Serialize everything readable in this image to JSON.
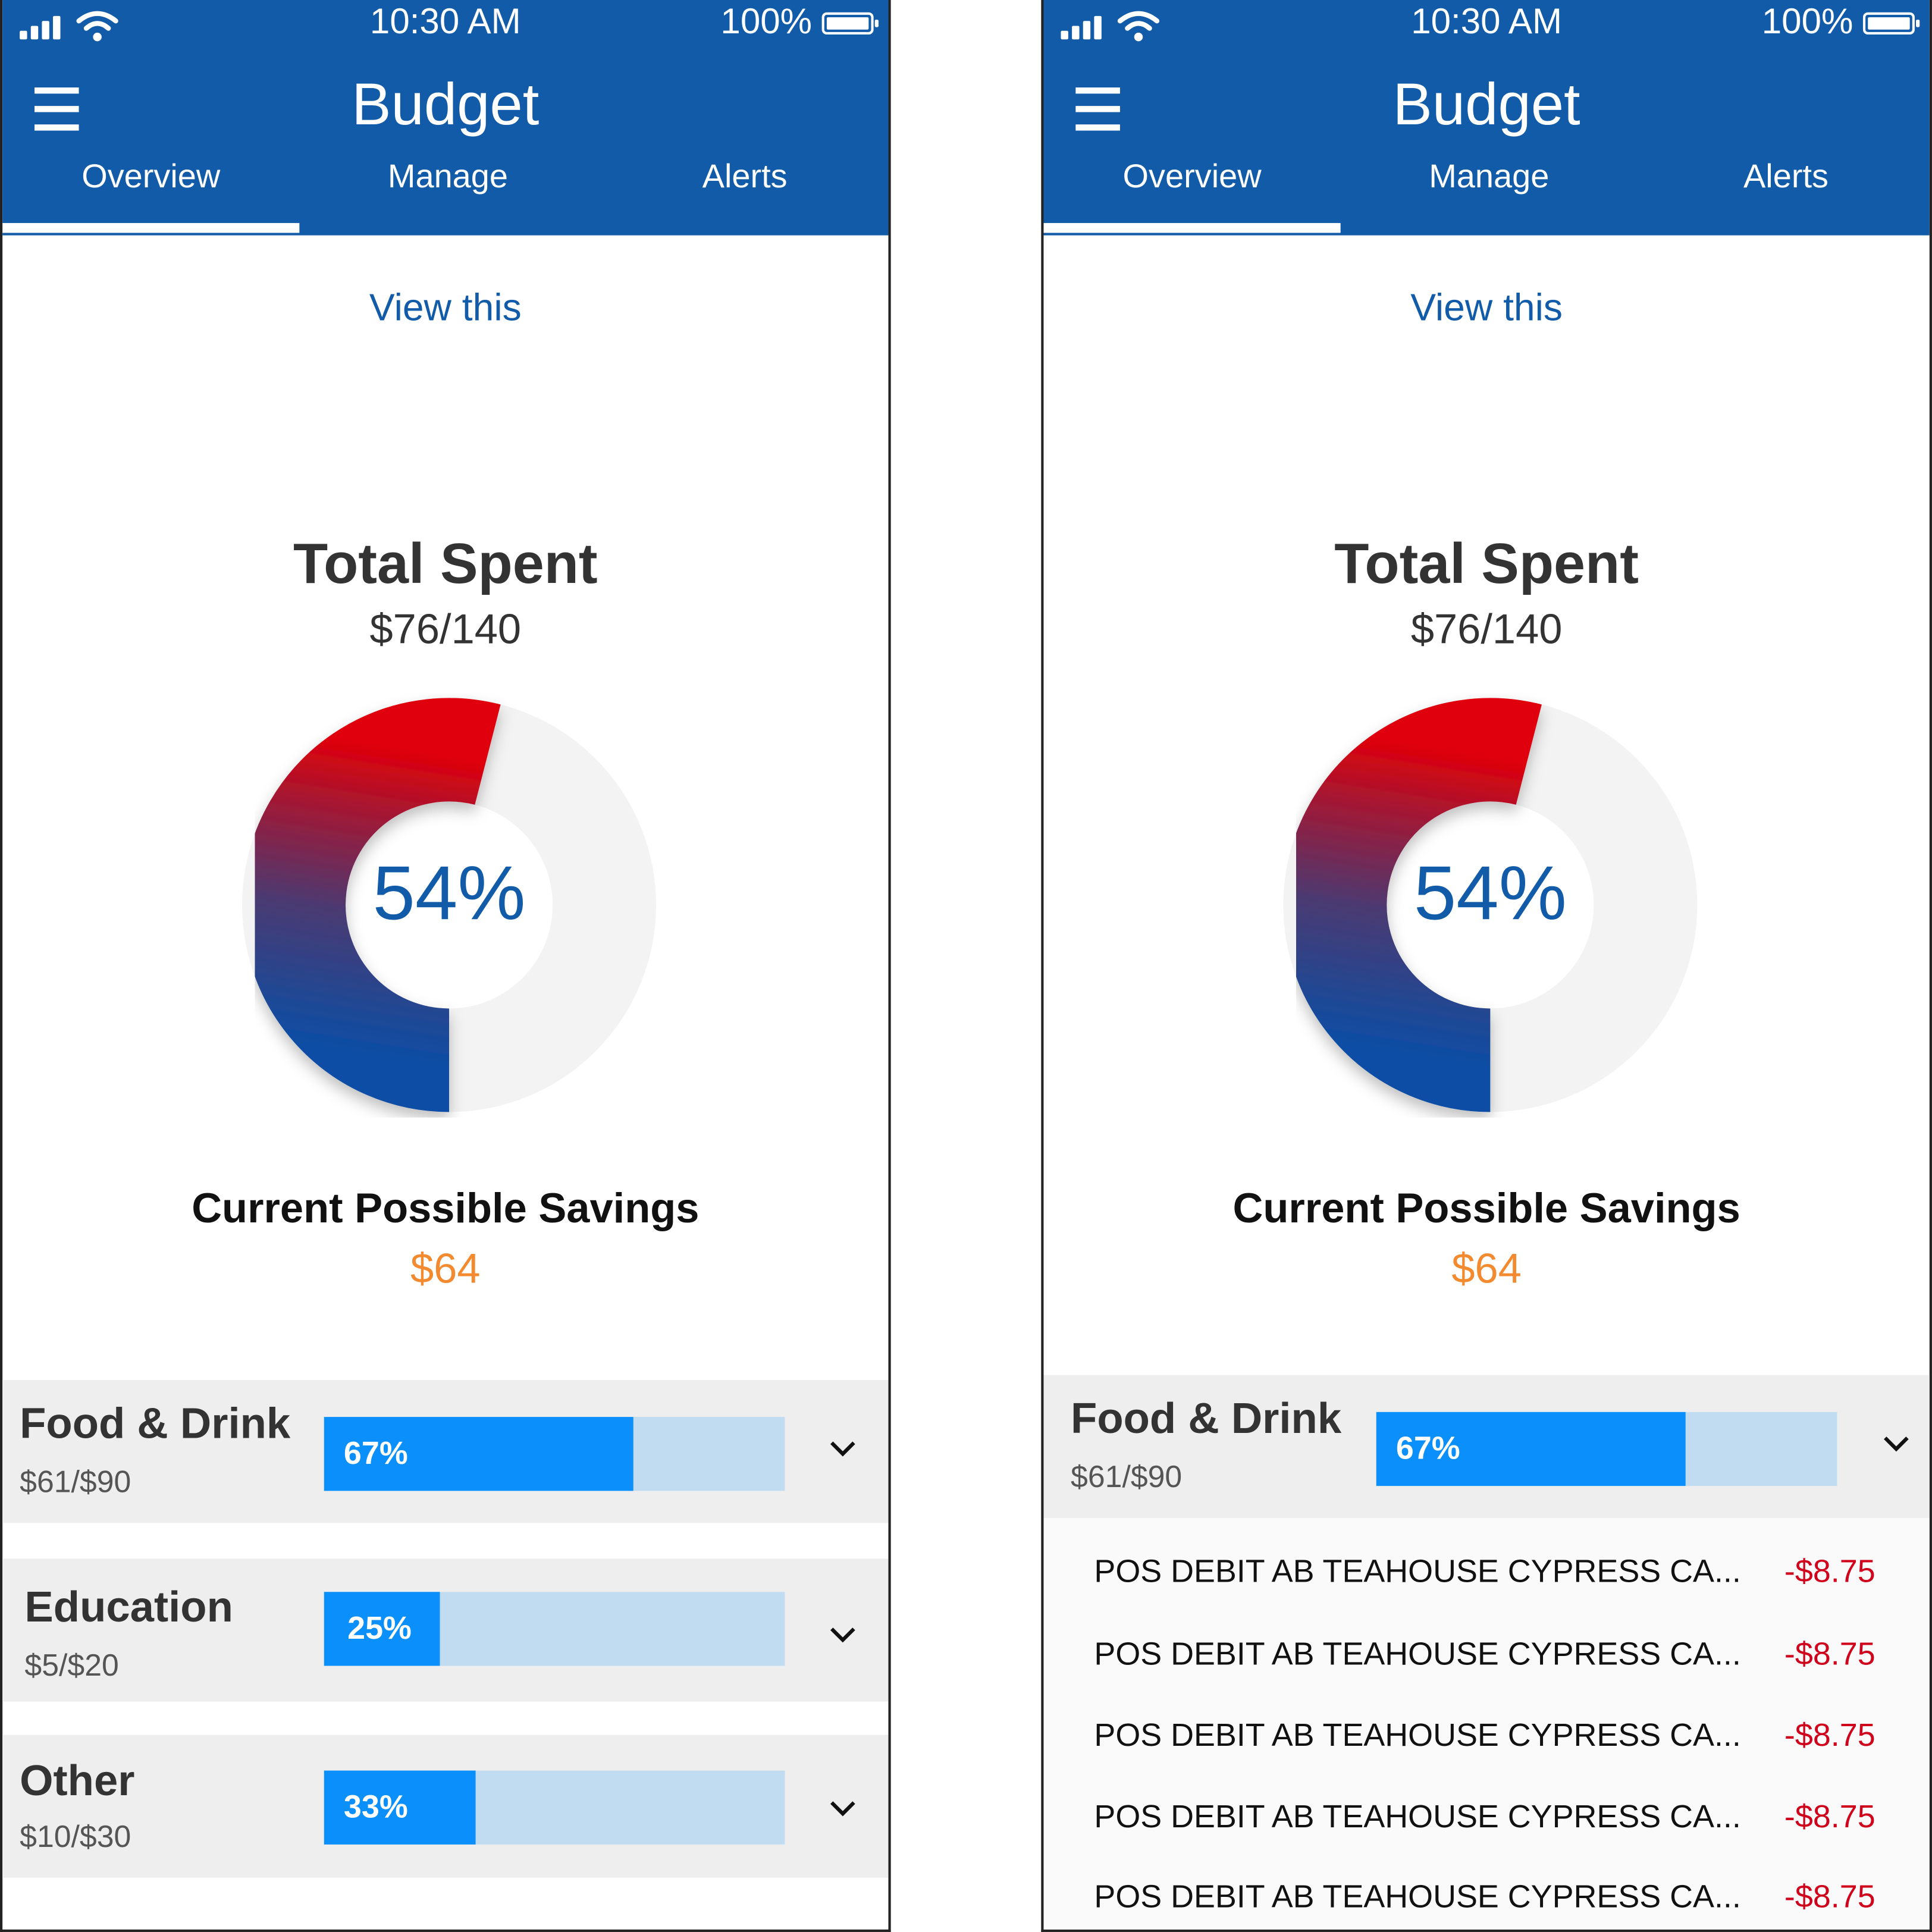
{
  "colors": {
    "header_bg": "#115ba8",
    "accent_blue": "#115ba8",
    "bar_fill": "#0b8ffa",
    "bar_track": "#c1dcf1",
    "savings_orange": "#f38a2f",
    "negative_red": "#d0021b",
    "donut_gradient_start": "#0b4ea5",
    "donut_gradient_end": "#e0000a"
  },
  "phones": [
    {
      "status": {
        "time": "10:30 AM",
        "battery": "100%"
      },
      "header": {
        "title": "Budget"
      },
      "tabs": [
        {
          "label": "Overview"
        },
        {
          "label": "Manage"
        },
        {
          "label": "Alerts"
        }
      ],
      "active_tab": "Overview",
      "view_this": "View this",
      "total": {
        "title": "Total Spent",
        "value": "$76/140",
        "percent_label": "54%",
        "percent": 54
      },
      "savings": {
        "title": "Current Possible Savings",
        "value": "$64"
      },
      "categories": [
        {
          "name": "Food & Drink",
          "amount": "$61/$90",
          "percent_label": "67%",
          "percent": 67,
          "expanded": false
        },
        {
          "name": "Education",
          "amount": "$5/$20",
          "percent_label": "25%",
          "percent": 25,
          "expanded": false
        },
        {
          "name": "Other",
          "amount": "$10/$30",
          "percent_label": "33%",
          "percent": 33,
          "expanded": false
        }
      ]
    },
    {
      "status": {
        "time": "10:30 AM",
        "battery": "100%"
      },
      "header": {
        "title": "Budget"
      },
      "tabs": [
        {
          "label": "Overview"
        },
        {
          "label": "Manage"
        },
        {
          "label": "Alerts"
        }
      ],
      "active_tab": "Overview",
      "view_this": "View this",
      "total": {
        "title": "Total Spent",
        "value": "$76/140",
        "percent_label": "54%",
        "percent": 54
      },
      "savings": {
        "title": "Current Possible Savings",
        "value": "$64"
      },
      "categories": [
        {
          "name": "Food & Drink",
          "amount": "$61/$90",
          "percent_label": "67%",
          "percent": 67,
          "expanded": true
        }
      ],
      "transactions": [
        {
          "description": "POS DEBIT AB TEAHOUSE CYPRESS CA...",
          "amount": "-$8.75"
        },
        {
          "description": "POS DEBIT AB TEAHOUSE CYPRESS CA...",
          "amount": "-$8.75"
        },
        {
          "description": "POS DEBIT AB TEAHOUSE CYPRESS CA...",
          "amount": "-$8.75"
        },
        {
          "description": "POS DEBIT AB TEAHOUSE CYPRESS CA...",
          "amount": "-$8.75"
        },
        {
          "description": "POS DEBIT AB TEAHOUSE CYPRESS CA...",
          "amount": "-$8.75"
        }
      ]
    }
  ]
}
